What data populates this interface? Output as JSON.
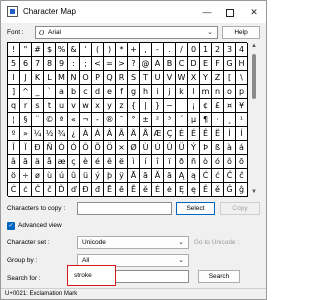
{
  "window": {
    "title": "Character Map",
    "minimize_glyph": "—",
    "close_glyph": "✕"
  },
  "font": {
    "label": "Font :",
    "icon_glyph": "O",
    "value": "Arial",
    "help_label": "Help"
  },
  "grid": {
    "characters": [
      "!",
      "\"",
      "#",
      "$",
      "%",
      "&",
      "'",
      "(",
      ")",
      "*",
      "+",
      ",",
      "-",
      ".",
      "/",
      "0",
      "1",
      "2",
      "3",
      "4",
      "5",
      "6",
      "7",
      "8",
      "9",
      ":",
      ";",
      "<",
      "=",
      ">",
      "?",
      "@",
      "A",
      "B",
      "C",
      "D",
      "E",
      "F",
      "G",
      "H",
      "I",
      "J",
      "K",
      "L",
      "M",
      "N",
      "O",
      "P",
      "Q",
      "R",
      "S",
      "T",
      "U",
      "V",
      "W",
      "X",
      "Y",
      "Z",
      "[",
      "\\",
      "]",
      "^",
      "_",
      "`",
      "a",
      "b",
      "c",
      "d",
      "e",
      "f",
      "g",
      "h",
      "i",
      "j",
      "k",
      "l",
      "m",
      "n",
      "o",
      "p",
      "q",
      "r",
      "s",
      "t",
      "u",
      "v",
      "w",
      "x",
      "y",
      "z",
      "{",
      "|",
      "}",
      "~",
      " ",
      "¡",
      "¢",
      "£",
      "¤",
      "¥",
      "¦",
      "§",
      "¨",
      "©",
      "ª",
      "«",
      "¬",
      "-",
      "®",
      "¯",
      "°",
      "±",
      "²",
      "³",
      "´",
      "µ",
      "¶",
      "·",
      "¸",
      "¹",
      "º",
      "»",
      "¼",
      "½",
      "¾",
      "¿",
      "À",
      "Á",
      "Â",
      "Ã",
      "Ä",
      "Å",
      "Æ",
      "Ç",
      "È",
      "É",
      "Ê",
      "Ë",
      "Ì",
      "Í",
      "Î",
      "Ï",
      "Ð",
      "Ñ",
      "Ò",
      "Ó",
      "Ô",
      "Õ",
      "Ö",
      "×",
      "Ø",
      "Ù",
      "Ú",
      "Û",
      "Ü",
      "Ý",
      "Þ",
      "ß",
      "à",
      "á",
      "â",
      "ã",
      "ä",
      "å",
      "æ",
      "ç",
      "è",
      "é",
      "ê",
      "ë",
      "ì",
      "í",
      "î",
      "ï",
      "ð",
      "ñ",
      "ò",
      "ó",
      "ô",
      "õ",
      "ö",
      "÷",
      "ø",
      "ù",
      "ú",
      "û",
      "ü",
      "ý",
      "þ",
      "ÿ",
      "Ā",
      "ā",
      "Ă",
      "ă",
      "Ą",
      "ą",
      "Ć",
      "ć",
      "Ĉ",
      "ĉ",
      "Ċ",
      "ċ",
      "Č",
      "č",
      "Ď",
      "ď",
      "Đ",
      "đ",
      "Ē",
      "ē",
      "Ĕ",
      "ĕ",
      "Ė",
      "ė",
      "Ę",
      "ę",
      "Ě",
      "ě",
      "Ĝ",
      "ĝ"
    ]
  },
  "copy": {
    "label": "Characters to copy :",
    "value": "",
    "select_label": "Select",
    "copy_label": "Copy"
  },
  "advanced": {
    "checked": true,
    "check_glyph": "✓",
    "label": "Advanced view"
  },
  "character_set": {
    "label": "Character set :",
    "value": "Unicode",
    "goto_label": "Go to Unicode :"
  },
  "group_by": {
    "label": "Group by :",
    "value": "All"
  },
  "search": {
    "label": "Search for :",
    "value": "stroke",
    "button_label": "Search"
  },
  "status": {
    "text": "U+0021: Exclamation Mark"
  },
  "icons": {
    "chevron_glyph": "⌄",
    "scroll_up_glyph": "▲",
    "scroll_down_glyph": "▼"
  },
  "colors": {
    "accent": "#0067c0",
    "highlight_border": "#d11a1a"
  }
}
